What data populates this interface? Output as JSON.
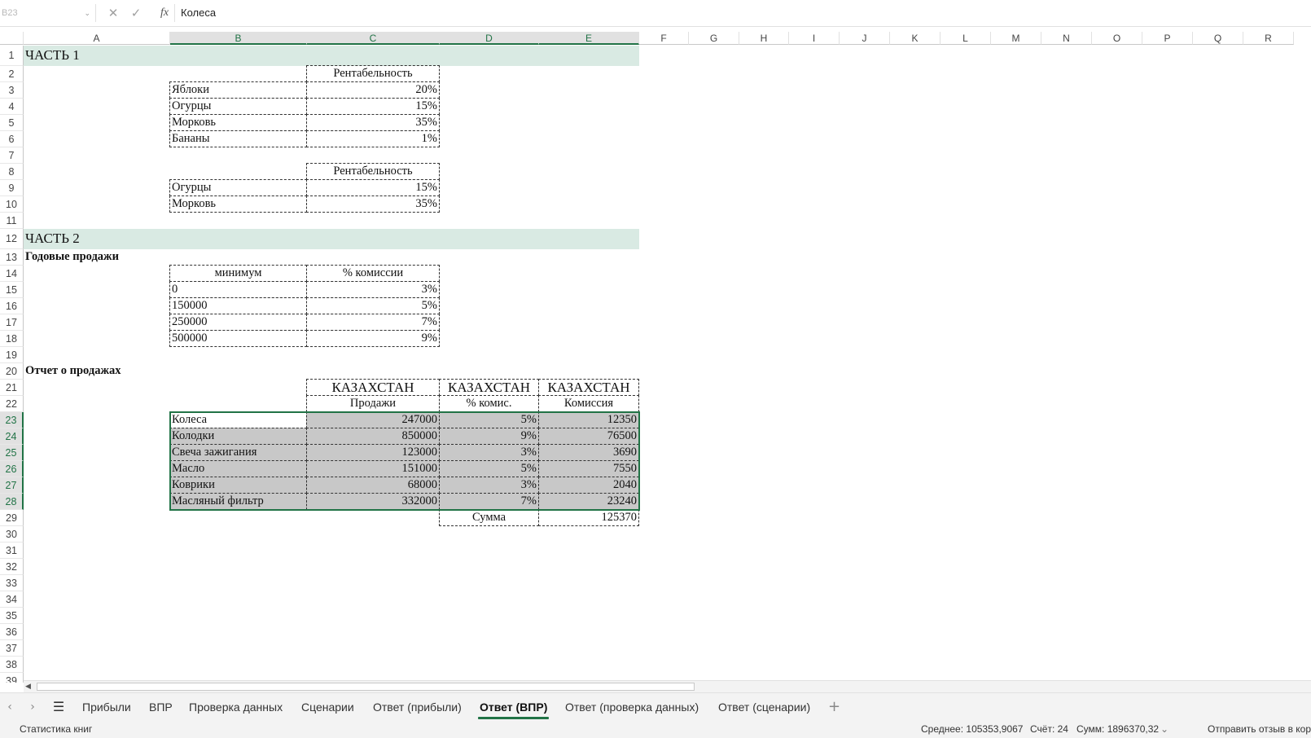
{
  "formula_bar": {
    "name_box": "B23",
    "value": "Колеса",
    "fx_label": "fx"
  },
  "columns": [
    "A",
    "B",
    "C",
    "D",
    "E",
    "F",
    "G",
    "H",
    "I",
    "J",
    "K",
    "L",
    "M",
    "N",
    "O",
    "P",
    "Q",
    "R"
  ],
  "rows": [
    "1",
    "2",
    "3",
    "4",
    "5",
    "6",
    "7",
    "8",
    "9",
    "10",
    "11",
    "12",
    "13",
    "14",
    "15",
    "16",
    "17",
    "18",
    "19",
    "20",
    "21",
    "22",
    "23",
    "24",
    "25",
    "26",
    "27",
    "28",
    "29",
    "30",
    "31",
    "32",
    "33",
    "34",
    "35",
    "36",
    "37",
    "38",
    "39"
  ],
  "part1": {
    "heading": "ЧАСТЬ 1",
    "table1": {
      "header": "Рентабельность",
      "rows": [
        {
          "name": "Яблоки",
          "value": "20%"
        },
        {
          "name": "Огурцы",
          "value": "15%"
        },
        {
          "name": "Морковь",
          "value": "35%"
        },
        {
          "name": "Бананы",
          "value": "1%"
        }
      ]
    },
    "table2": {
      "header": "Рентабельность",
      "rows": [
        {
          "name": "Огурцы",
          "value": "15%"
        },
        {
          "name": "Морковь",
          "value": "35%"
        }
      ]
    }
  },
  "part2": {
    "heading": "ЧАСТЬ 2",
    "annual_sales": {
      "title": "Годовые продажи",
      "headers": [
        "минимум",
        "% комиссии"
      ],
      "rows": [
        {
          "min": "0",
          "pct": "3%"
        },
        {
          "min": "150000",
          "pct": "5%"
        },
        {
          "min": "250000",
          "pct": "7%"
        },
        {
          "min": "500000",
          "pct": "9%"
        }
      ]
    },
    "sales_report": {
      "title": "Отчет о продажах",
      "region_headers": [
        "КАЗАХСТАН",
        "КАЗАХСТАН",
        "КАЗАХСТАН"
      ],
      "headers": [
        "Продажи",
        "% комис.",
        "Комиссия"
      ],
      "rows": [
        {
          "name": "Колеса",
          "sales": "247000",
          "pct": "5%",
          "commission": "12350"
        },
        {
          "name": "Колодки",
          "sales": "850000",
          "pct": "9%",
          "commission": "76500"
        },
        {
          "name": "Свеча зажигания",
          "sales": "123000",
          "pct": "3%",
          "commission": "3690"
        },
        {
          "name": "Масло",
          "sales": "151000",
          "pct": "5%",
          "commission": "7550"
        },
        {
          "name": "Коврики",
          "sales": "68000",
          "pct": "3%",
          "commission": "2040"
        },
        {
          "name": "Масляный фильтр",
          "sales": "332000",
          "pct": "7%",
          "commission": "23240"
        }
      ],
      "total_label": "Сумма",
      "total_value": "125370"
    }
  },
  "sheet_tabs": [
    {
      "label": "Прибыли",
      "active": false
    },
    {
      "label": "ВПР",
      "active": false
    },
    {
      "label": "Проверка данных",
      "active": false
    },
    {
      "label": "Сценарии",
      "active": false
    },
    {
      "label": "Ответ (прибыли)",
      "active": false
    },
    {
      "label": "Ответ (ВПР)",
      "active": true
    },
    {
      "label": "Ответ (проверка данных)",
      "active": false
    },
    {
      "label": "Ответ (сценарии)",
      "active": false
    }
  ],
  "status_bar": {
    "left": "Статистика книг",
    "average": "Среднее: 105353,9067",
    "count": "Счёт: 24",
    "sum": "Сумм: 1896370,32",
    "feedback": "Отправить отзыв в кор"
  },
  "icons": {
    "cancel": "x-icon",
    "enter": "check-icon",
    "sheet_menu": "hamburger-icon",
    "add_sheet": "plus-icon"
  },
  "colors": {
    "accent": "#217346",
    "band": "#d9eae3",
    "shade": "#c8c8c8"
  }
}
